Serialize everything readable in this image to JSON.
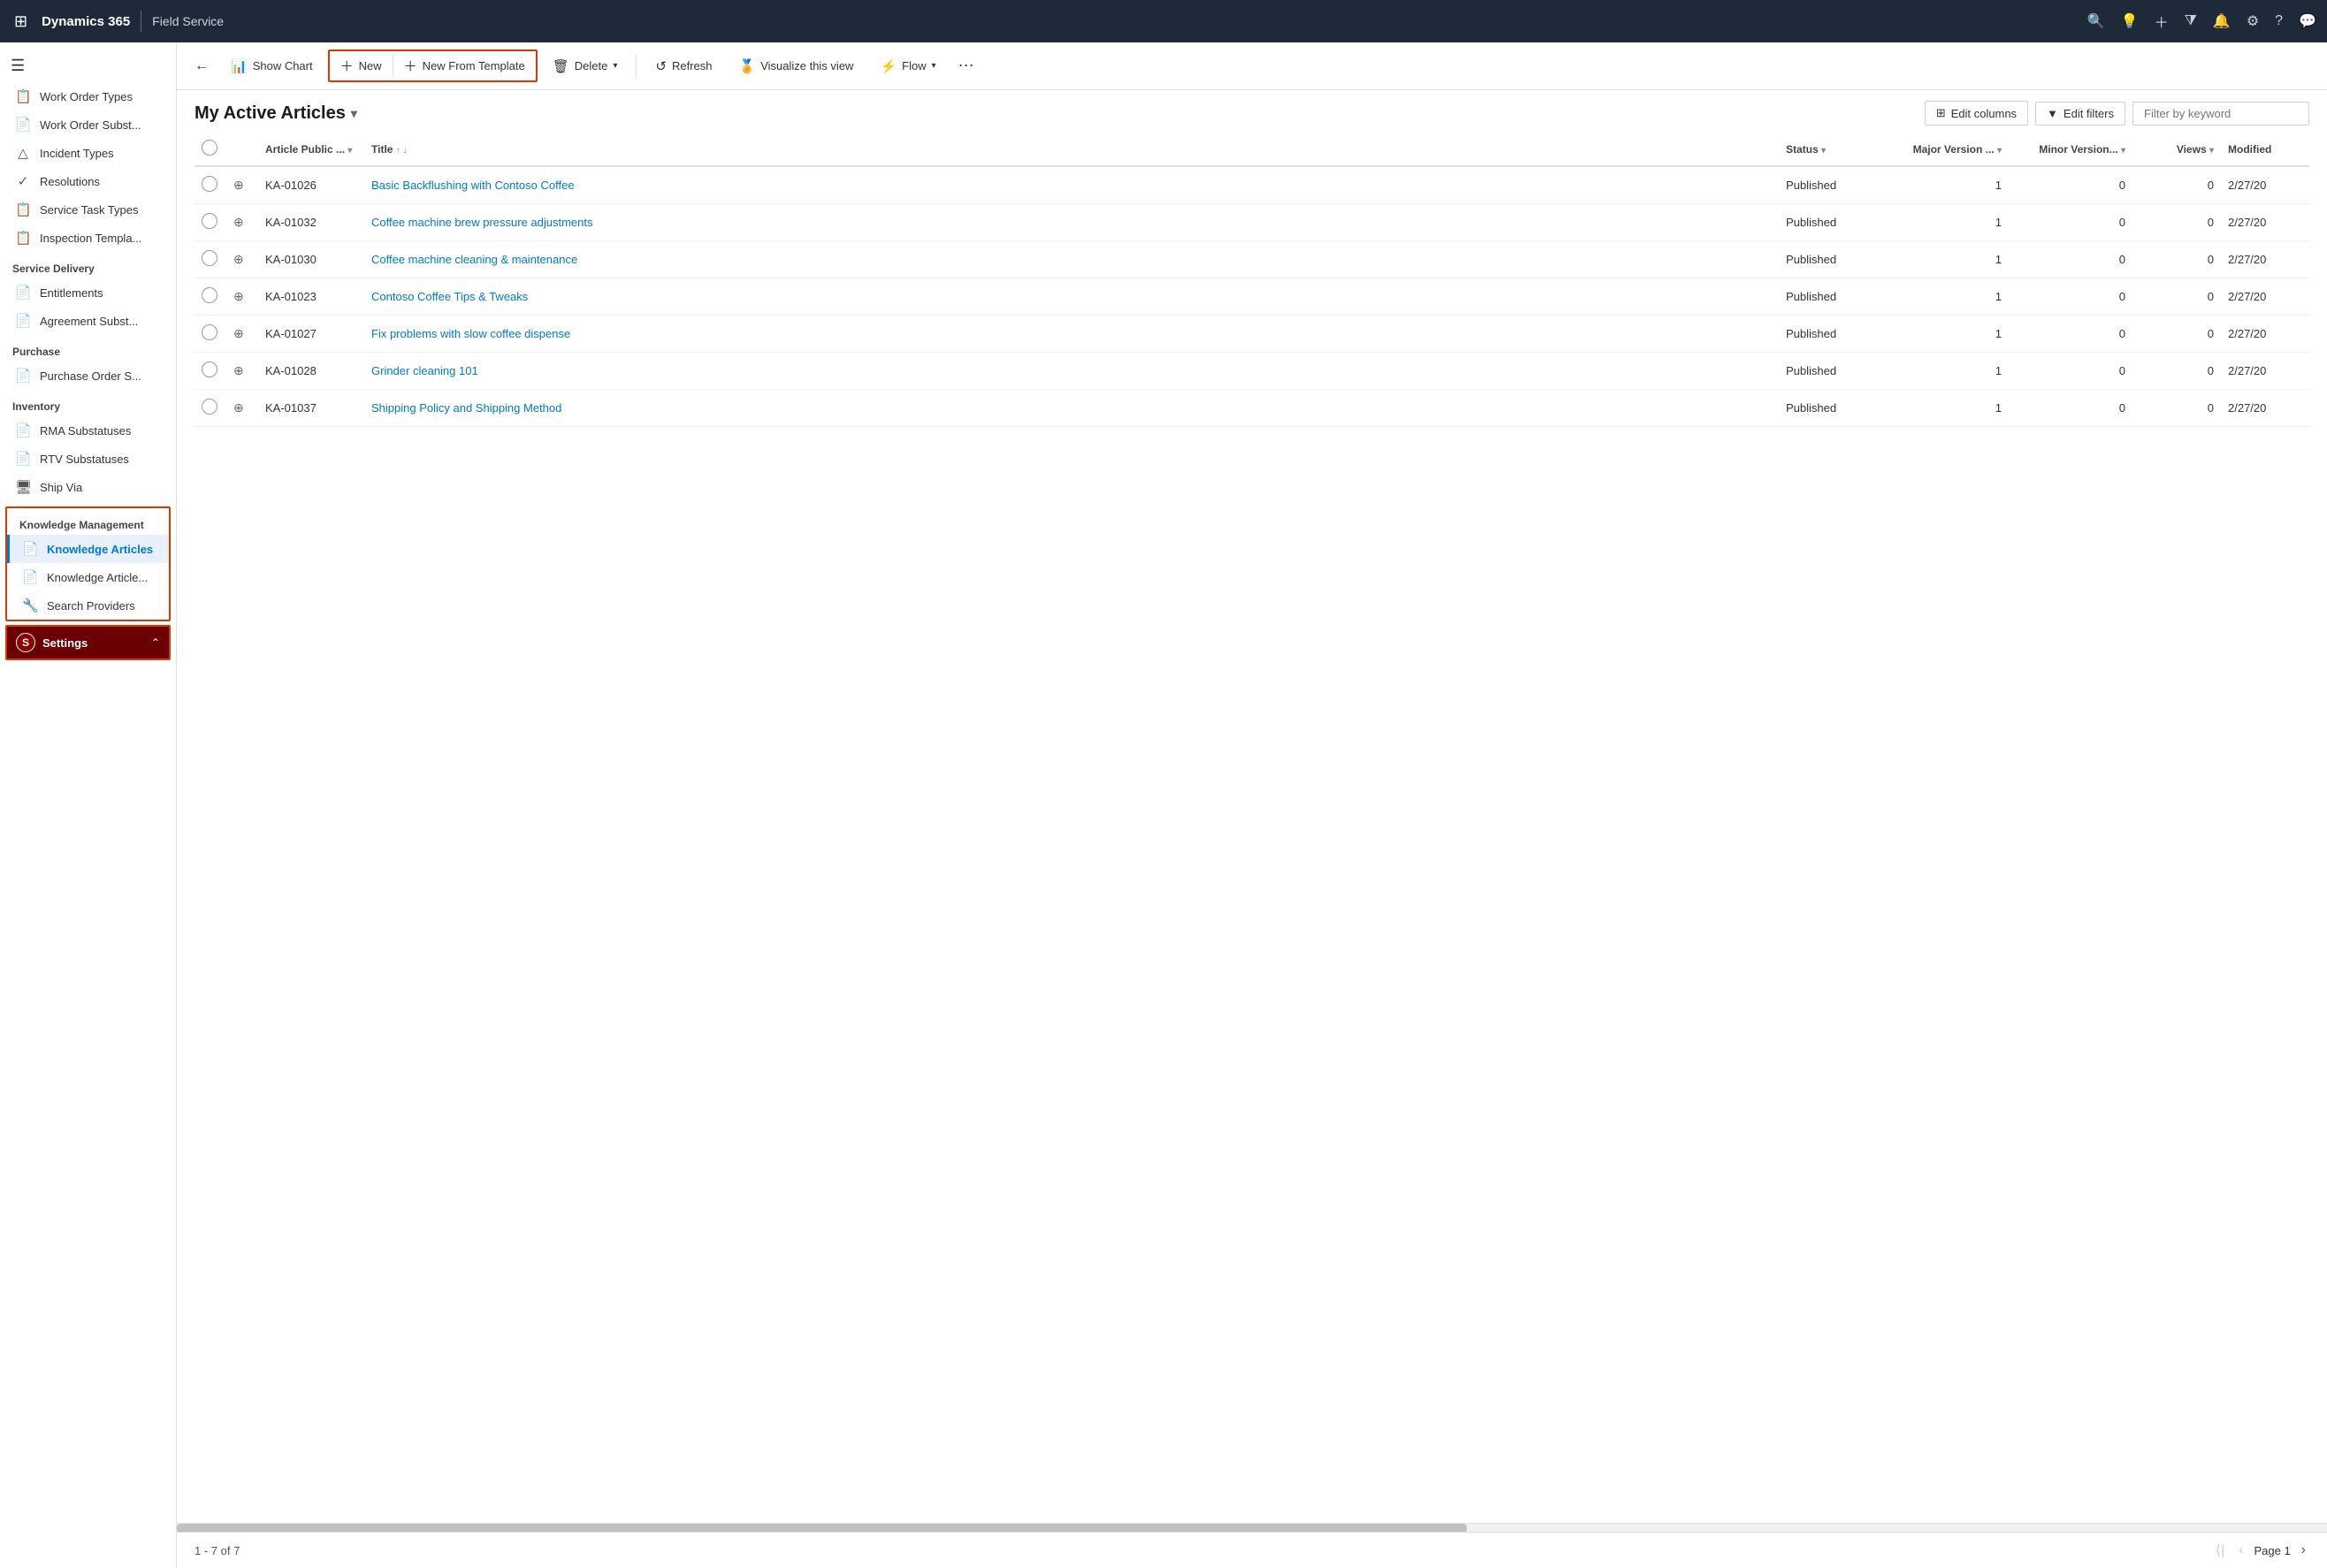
{
  "topNav": {
    "waffle": "⊞",
    "brand": "Dynamics 365",
    "divider": true,
    "app": "Field Service",
    "icons": [
      "🔍",
      "💡",
      "+",
      "▼",
      "🔔",
      "⚙",
      "?",
      "💬"
    ]
  },
  "sidebar": {
    "hamburger": "☰",
    "items": [
      {
        "id": "work-order-types",
        "icon": "📋",
        "label": "Work Order Types",
        "active": false
      },
      {
        "id": "work-order-subst",
        "icon": "📄",
        "label": "Work Order Subst...",
        "active": false
      },
      {
        "id": "incident-types",
        "icon": "△",
        "label": "Incident Types",
        "active": false
      },
      {
        "id": "resolutions",
        "icon": "✓",
        "label": "Resolutions",
        "active": false
      },
      {
        "id": "service-task-types",
        "icon": "📋",
        "label": "Service Task Types",
        "active": false
      },
      {
        "id": "inspection-templates",
        "icon": "📋",
        "label": "Inspection Templa...",
        "active": false
      }
    ],
    "sections": [
      {
        "label": "Service Delivery",
        "items": [
          {
            "id": "entitlements",
            "icon": "📄",
            "label": "Entitlements"
          },
          {
            "id": "agreement-subst",
            "icon": "📄",
            "label": "Agreement Subst..."
          }
        ]
      },
      {
        "label": "Purchase",
        "items": [
          {
            "id": "purchase-order-s",
            "icon": "📄",
            "label": "Purchase Order S..."
          }
        ]
      },
      {
        "label": "Inventory",
        "items": [
          {
            "id": "rma-substatuses",
            "icon": "📄",
            "label": "RMA Substatuses"
          },
          {
            "id": "rtv-substatuses",
            "icon": "📄",
            "label": "RTV Substatuses"
          },
          {
            "id": "ship-via",
            "icon": "🖥",
            "label": "Ship Via"
          }
        ]
      },
      {
        "label": "Knowledge Management",
        "highlighted": true,
        "items": [
          {
            "id": "knowledge-articles",
            "icon": "📄",
            "label": "Knowledge Articles",
            "active": true
          },
          {
            "id": "knowledge-article-v",
            "icon": "📄",
            "label": "Knowledge Article..."
          },
          {
            "id": "search-providers",
            "icon": "🔧",
            "label": "Search Providers"
          }
        ]
      }
    ],
    "settings": {
      "avatar": "S",
      "label": "Settings",
      "chevron": "⌃"
    }
  },
  "toolbar": {
    "back_icon": "←",
    "show_chart": "Show Chart",
    "new": "New",
    "new_from_template": "New From Template",
    "delete": "Delete",
    "delete_chevron": "▾",
    "refresh": "Refresh",
    "visualize": "Visualize this view",
    "flow": "Flow",
    "flow_chevron": "▾",
    "more_icon": "⋯"
  },
  "view": {
    "title": "My Active Articles",
    "title_chevron": "▾",
    "edit_columns_icon": "⊞",
    "edit_columns": "Edit columns",
    "edit_filters_icon": "▼",
    "edit_filters": "Edit filters",
    "filter_placeholder": "Filter by keyword"
  },
  "table": {
    "columns": [
      {
        "id": "col-pubnum",
        "label": "Article Public ...",
        "sortable": true,
        "chevron": true
      },
      {
        "id": "col-title",
        "label": "Title",
        "sortable": true,
        "sort": "asc"
      },
      {
        "id": "col-status",
        "label": "Status",
        "sortable": true
      },
      {
        "id": "col-major",
        "label": "Major Version ...",
        "sortable": true,
        "align": "right"
      },
      {
        "id": "col-minor",
        "label": "Minor Version...",
        "sortable": true,
        "align": "right"
      },
      {
        "id": "col-views",
        "label": "Views",
        "sortable": true,
        "align": "right"
      },
      {
        "id": "col-modified",
        "label": "Modified"
      }
    ],
    "rows": [
      {
        "id": "row-1",
        "pubnum": "KA-01026",
        "title": "Basic Backflushing with Contoso Coffee",
        "status": "Published",
        "major": "1",
        "minor": "0",
        "views": "0",
        "modified": "2/27/20"
      },
      {
        "id": "row-2",
        "pubnum": "KA-01032",
        "title": "Coffee machine brew pressure adjustments",
        "status": "Published",
        "major": "1",
        "minor": "0",
        "views": "0",
        "modified": "2/27/20"
      },
      {
        "id": "row-3",
        "pubnum": "KA-01030",
        "title": "Coffee machine cleaning & maintenance",
        "status": "Published",
        "major": "1",
        "minor": "0",
        "views": "0",
        "modified": "2/27/20"
      },
      {
        "id": "row-4",
        "pubnum": "KA-01023",
        "title": "Contoso Coffee Tips & Tweaks",
        "status": "Published",
        "major": "1",
        "minor": "0",
        "views": "0",
        "modified": "2/27/20"
      },
      {
        "id": "row-5",
        "pubnum": "KA-01027",
        "title": "Fix problems with slow coffee dispense",
        "status": "Published",
        "major": "1",
        "minor": "0",
        "views": "0",
        "modified": "2/27/20"
      },
      {
        "id": "row-6",
        "pubnum": "KA-01028",
        "title": "Grinder cleaning 101",
        "status": "Published",
        "major": "1",
        "minor": "0",
        "views": "0",
        "modified": "2/27/20"
      },
      {
        "id": "row-7",
        "pubnum": "KA-01037",
        "title": "Shipping Policy and Shipping Method",
        "status": "Published",
        "major": "1",
        "minor": "0",
        "views": "0",
        "modified": "2/27/20"
      }
    ]
  },
  "footer": {
    "count": "1 - 7 of 7",
    "page_label": "Page 1"
  }
}
